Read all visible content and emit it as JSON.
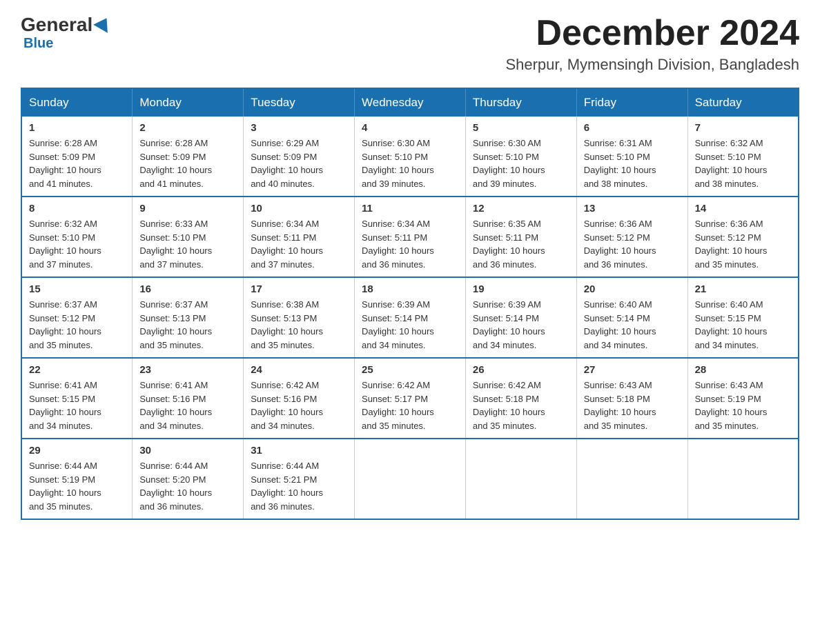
{
  "logo": {
    "general": "General",
    "blue": "Blue"
  },
  "header": {
    "month": "December 2024",
    "location": "Sherpur, Mymensingh Division, Bangladesh"
  },
  "weekdays": [
    "Sunday",
    "Monday",
    "Tuesday",
    "Wednesday",
    "Thursday",
    "Friday",
    "Saturday"
  ],
  "weeks": [
    [
      {
        "day": "1",
        "sunrise": "6:28 AM",
        "sunset": "5:09 PM",
        "daylight": "10 hours and 41 minutes."
      },
      {
        "day": "2",
        "sunrise": "6:28 AM",
        "sunset": "5:09 PM",
        "daylight": "10 hours and 41 minutes."
      },
      {
        "day": "3",
        "sunrise": "6:29 AM",
        "sunset": "5:09 PM",
        "daylight": "10 hours and 40 minutes."
      },
      {
        "day": "4",
        "sunrise": "6:30 AM",
        "sunset": "5:10 PM",
        "daylight": "10 hours and 39 minutes."
      },
      {
        "day": "5",
        "sunrise": "6:30 AM",
        "sunset": "5:10 PM",
        "daylight": "10 hours and 39 minutes."
      },
      {
        "day": "6",
        "sunrise": "6:31 AM",
        "sunset": "5:10 PM",
        "daylight": "10 hours and 38 minutes."
      },
      {
        "day": "7",
        "sunrise": "6:32 AM",
        "sunset": "5:10 PM",
        "daylight": "10 hours and 38 minutes."
      }
    ],
    [
      {
        "day": "8",
        "sunrise": "6:32 AM",
        "sunset": "5:10 PM",
        "daylight": "10 hours and 37 minutes."
      },
      {
        "day": "9",
        "sunrise": "6:33 AM",
        "sunset": "5:10 PM",
        "daylight": "10 hours and 37 minutes."
      },
      {
        "day": "10",
        "sunrise": "6:34 AM",
        "sunset": "5:11 PM",
        "daylight": "10 hours and 37 minutes."
      },
      {
        "day": "11",
        "sunrise": "6:34 AM",
        "sunset": "5:11 PM",
        "daylight": "10 hours and 36 minutes."
      },
      {
        "day": "12",
        "sunrise": "6:35 AM",
        "sunset": "5:11 PM",
        "daylight": "10 hours and 36 minutes."
      },
      {
        "day": "13",
        "sunrise": "6:36 AM",
        "sunset": "5:12 PM",
        "daylight": "10 hours and 36 minutes."
      },
      {
        "day": "14",
        "sunrise": "6:36 AM",
        "sunset": "5:12 PM",
        "daylight": "10 hours and 35 minutes."
      }
    ],
    [
      {
        "day": "15",
        "sunrise": "6:37 AM",
        "sunset": "5:12 PM",
        "daylight": "10 hours and 35 minutes."
      },
      {
        "day": "16",
        "sunrise": "6:37 AM",
        "sunset": "5:13 PM",
        "daylight": "10 hours and 35 minutes."
      },
      {
        "day": "17",
        "sunrise": "6:38 AM",
        "sunset": "5:13 PM",
        "daylight": "10 hours and 35 minutes."
      },
      {
        "day": "18",
        "sunrise": "6:39 AM",
        "sunset": "5:14 PM",
        "daylight": "10 hours and 34 minutes."
      },
      {
        "day": "19",
        "sunrise": "6:39 AM",
        "sunset": "5:14 PM",
        "daylight": "10 hours and 34 minutes."
      },
      {
        "day": "20",
        "sunrise": "6:40 AM",
        "sunset": "5:14 PM",
        "daylight": "10 hours and 34 minutes."
      },
      {
        "day": "21",
        "sunrise": "6:40 AM",
        "sunset": "5:15 PM",
        "daylight": "10 hours and 34 minutes."
      }
    ],
    [
      {
        "day": "22",
        "sunrise": "6:41 AM",
        "sunset": "5:15 PM",
        "daylight": "10 hours and 34 minutes."
      },
      {
        "day": "23",
        "sunrise": "6:41 AM",
        "sunset": "5:16 PM",
        "daylight": "10 hours and 34 minutes."
      },
      {
        "day": "24",
        "sunrise": "6:42 AM",
        "sunset": "5:16 PM",
        "daylight": "10 hours and 34 minutes."
      },
      {
        "day": "25",
        "sunrise": "6:42 AM",
        "sunset": "5:17 PM",
        "daylight": "10 hours and 35 minutes."
      },
      {
        "day": "26",
        "sunrise": "6:42 AM",
        "sunset": "5:18 PM",
        "daylight": "10 hours and 35 minutes."
      },
      {
        "day": "27",
        "sunrise": "6:43 AM",
        "sunset": "5:18 PM",
        "daylight": "10 hours and 35 minutes."
      },
      {
        "day": "28",
        "sunrise": "6:43 AM",
        "sunset": "5:19 PM",
        "daylight": "10 hours and 35 minutes."
      }
    ],
    [
      {
        "day": "29",
        "sunrise": "6:44 AM",
        "sunset": "5:19 PM",
        "daylight": "10 hours and 35 minutes."
      },
      {
        "day": "30",
        "sunrise": "6:44 AM",
        "sunset": "5:20 PM",
        "daylight": "10 hours and 36 minutes."
      },
      {
        "day": "31",
        "sunrise": "6:44 AM",
        "sunset": "5:21 PM",
        "daylight": "10 hours and 36 minutes."
      },
      null,
      null,
      null,
      null
    ]
  ],
  "labels": {
    "sunrise": "Sunrise:",
    "sunset": "Sunset:",
    "daylight": "Daylight:"
  }
}
